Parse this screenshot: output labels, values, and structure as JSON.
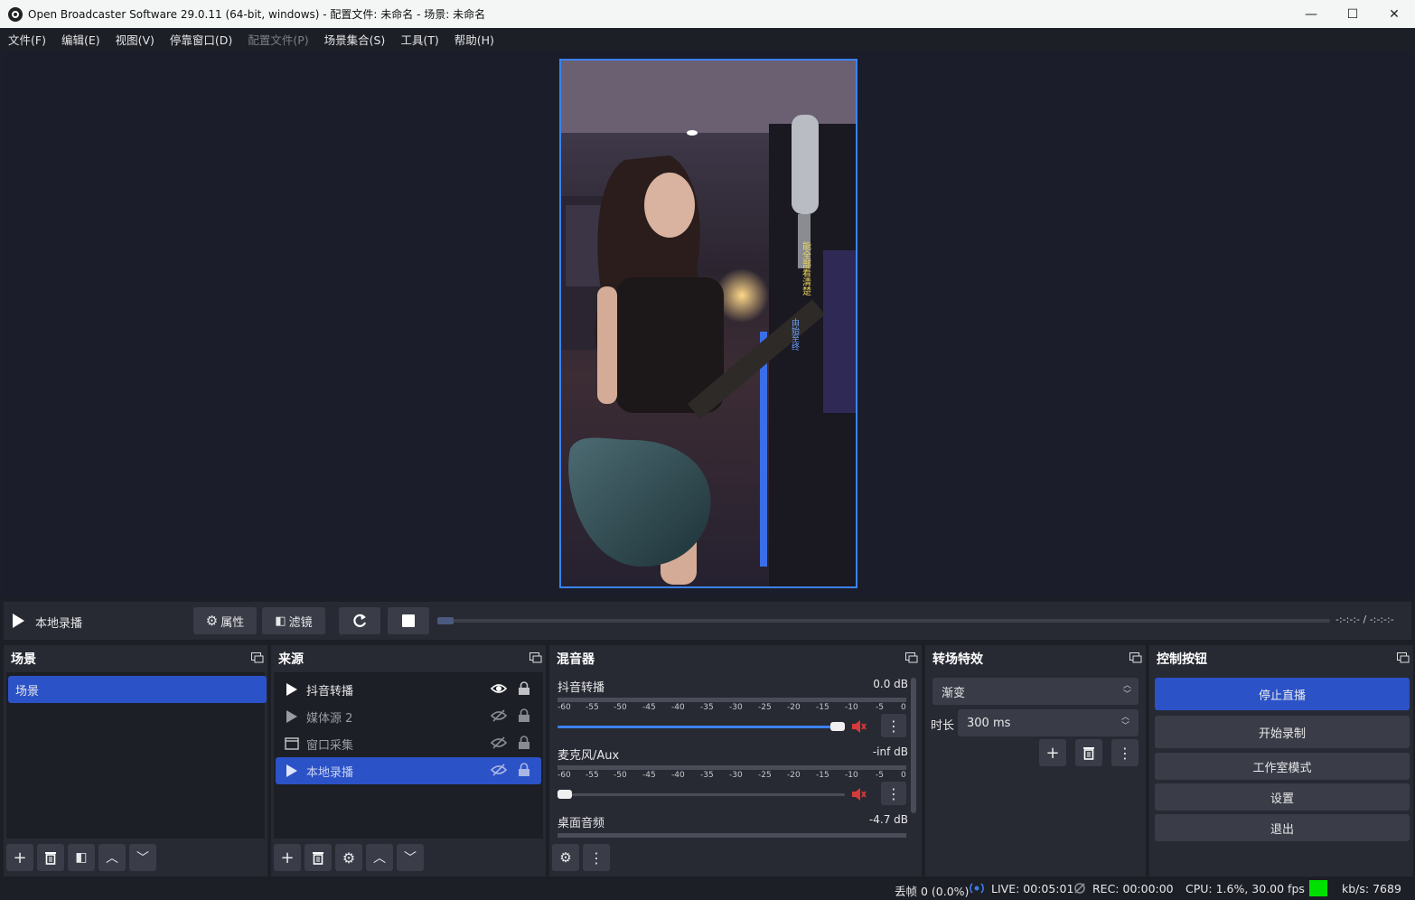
{
  "window": {
    "title": "Open Broadcaster Software 29.0.11 (64-bit, windows) - 配置文件: 未命名 - 场景: 未命名",
    "minimize_glyph": "—",
    "maximize_glyph": "☐",
    "close_glyph": "✕"
  },
  "menu": [
    {
      "label": "文件(F)",
      "enabled": true
    },
    {
      "label": "编辑(E)",
      "enabled": true
    },
    {
      "label": "视图(V)",
      "enabled": true
    },
    {
      "label": "停靠窗口(D)",
      "enabled": true
    },
    {
      "label": "配置文件(P)",
      "enabled": false
    },
    {
      "label": "场景集合(S)",
      "enabled": true
    },
    {
      "label": "工具(T)",
      "enabled": true
    },
    {
      "label": "帮助(H)",
      "enabled": true
    }
  ],
  "preview": {
    "overlay_text_1": "能全部看清楚",
    "overlay_text_2": "由始至终"
  },
  "media_controls": {
    "source_name": "本地录播",
    "properties_label": "属性",
    "filters_label": "滤镜",
    "time_display": "-:-:-:-  /  -:-:-:-",
    "progress": 0
  },
  "docks": {
    "scenes": {
      "title": "场景",
      "items": [
        "场景"
      ],
      "selected_index": 0
    },
    "sources": {
      "title": "来源",
      "items": [
        {
          "name": "抖音转播",
          "type": "media",
          "visible": true,
          "locked": true,
          "selected": false
        },
        {
          "name": "媒体源 2",
          "type": "media",
          "visible": false,
          "locked": true,
          "selected": false
        },
        {
          "name": "窗口采集",
          "type": "window",
          "visible": false,
          "locked": true,
          "selected": false
        },
        {
          "name": "本地录播",
          "type": "media",
          "visible": false,
          "locked": true,
          "selected": true
        }
      ]
    },
    "mixer": {
      "title": "混音器",
      "meter_ticks": [
        "-60",
        "-55",
        "-50",
        "-45",
        "-40",
        "-35",
        "-30",
        "-25",
        "-20",
        "-15",
        "-10",
        "-5",
        "0"
      ],
      "channels": [
        {
          "name": "抖音转播",
          "db": "0.0 dB",
          "volume_fraction": 1.0,
          "muted": true
        },
        {
          "name": "麦克风/Aux",
          "db": "-inf dB",
          "volume_fraction": 0.0,
          "muted": true
        },
        {
          "name": "桌面音频",
          "db": "-4.7 dB",
          "volume_fraction": 0.85,
          "muted": false
        }
      ]
    },
    "transitions": {
      "title": "转场特效",
      "selected_transition": "渐变",
      "duration_label": "时长",
      "duration_value": "300 ms"
    },
    "controls": {
      "title": "控制按钮",
      "buttons": [
        "停止直播",
        "开始录制",
        "工作室模式",
        "设置",
        "退出"
      ]
    }
  },
  "status": {
    "dropped_frames": "丢帧 0 (0.0%)",
    "live": "LIVE: 00:05:01",
    "rec": "REC: 00:00:00",
    "cpu": "CPU: 1.6%, 30.00 fps",
    "bitrate": "kb/s: 7689",
    "health_color": "#00e000"
  },
  "colors": {
    "accent": "#2b52c7",
    "mute_red": "#d63a3a"
  }
}
